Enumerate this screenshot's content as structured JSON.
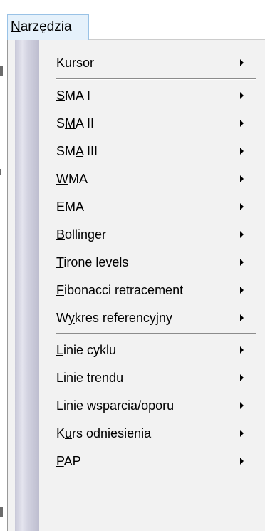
{
  "menubar": {
    "label_prefix": "",
    "mnemonic": "N",
    "label_rest": "arzędzia"
  },
  "menu": {
    "items": [
      {
        "pre": "",
        "key": "K",
        "post": "ursor"
      },
      {
        "pre": "",
        "key": "S",
        "post": "MA I"
      },
      {
        "pre": "S",
        "key": "M",
        "post": "A II"
      },
      {
        "pre": "SM",
        "key": "A",
        "post": " III"
      },
      {
        "pre": "",
        "key": "W",
        "post": "MA"
      },
      {
        "pre": "",
        "key": "E",
        "post": "MA"
      },
      {
        "pre": "",
        "key": "B",
        "post": "ollinger"
      },
      {
        "pre": "",
        "key": "T",
        "post": "irone levels"
      },
      {
        "pre": "",
        "key": "F",
        "post": "ibonacci retracement"
      },
      {
        "pre": "W",
        "key": "y",
        "post": "kres referencyjny"
      },
      {
        "pre": "",
        "key": "L",
        "post": "inie cyklu"
      },
      {
        "pre": "L",
        "key": "i",
        "post": "nie trendu"
      },
      {
        "pre": "Li",
        "key": "n",
        "post": "ie wsparcia/oporu"
      },
      {
        "pre": "K",
        "key": "u",
        "post": "rs odniesienia"
      },
      {
        "pre": "",
        "key": "P",
        "post": "AP"
      }
    ]
  }
}
